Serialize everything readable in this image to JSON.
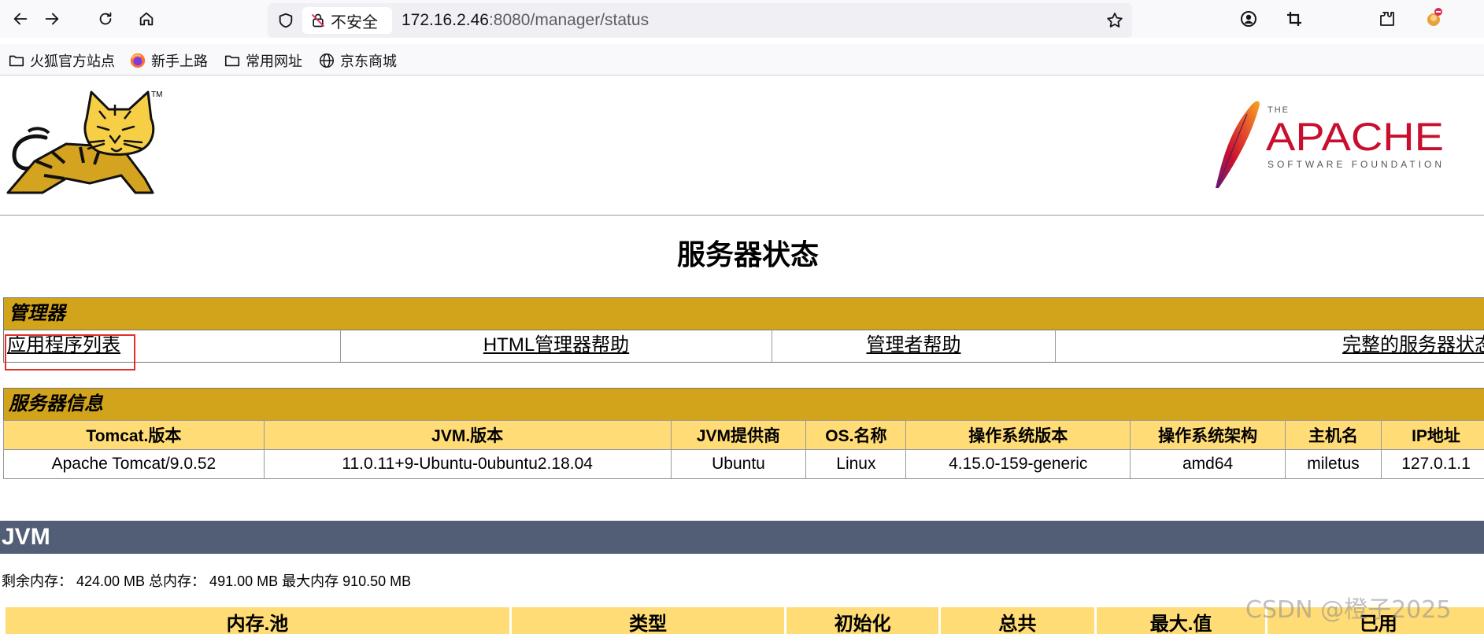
{
  "browser": {
    "url_host": "172.16.2.46",
    "url_path": ":8080/manager/status",
    "security_label": "不安全",
    "bookmarks": [
      {
        "label": "火狐官方站点",
        "icon": "folder-icon"
      },
      {
        "label": "新手上路",
        "icon": "firefox-icon"
      },
      {
        "label": "常用网址",
        "icon": "folder-icon"
      },
      {
        "label": "京东商城",
        "icon": "globe-icon"
      }
    ]
  },
  "page": {
    "title": "服务器状态",
    "manager": {
      "heading": "管理器",
      "links": [
        "应用程序列表",
        "HTML管理器帮助",
        "管理者帮助",
        "完整的服务器状态"
      ]
    },
    "server_info": {
      "heading": "服务器信息",
      "columns": [
        "Tomcat.版本",
        "JVM.版本",
        "JVM提供商",
        "OS.名称",
        "操作系统版本",
        "操作系统架构",
        "主机名",
        "IP地址"
      ],
      "values": [
        "Apache Tomcat/9.0.52",
        "11.0.11+9-Ubuntu-0ubuntu2.18.04",
        "Ubuntu",
        "Linux",
        "4.15.0-159-generic",
        "amd64",
        "miletus",
        "127.0.1.1"
      ]
    },
    "jvm": {
      "heading": "JVM",
      "memory_line": "剩余内存： 424.00 MB 总内存： 491.00 MB 最大内存 910.50 MB",
      "pool_columns": [
        "内存.池",
        "类型",
        "初始化",
        "总共",
        "最大.值",
        "已用"
      ]
    }
  },
  "logos": {
    "apache_the": "THE",
    "apache_name": "APACHE",
    "apache_sub": "SOFTWARE FOUNDATION",
    "tomcat_tm": "TM"
  },
  "watermark": "CSDN @橙子2025",
  "colors": {
    "section_header": "#d2a41c",
    "table_header": "#ffdc75",
    "jvm_bar": "#525d76",
    "highlight_box": "#e0302a",
    "apache_red": "#c8102e"
  }
}
